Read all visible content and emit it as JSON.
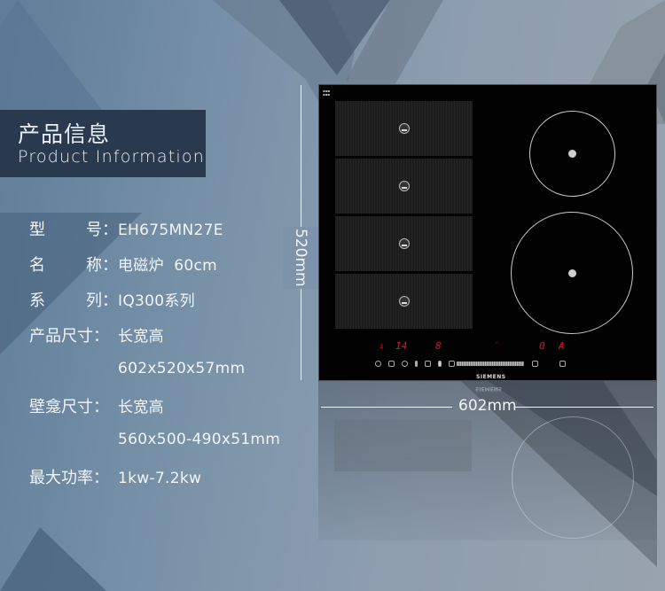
{
  "header": {
    "title_cn": "产品信息",
    "title_en": "Product Information"
  },
  "specs": [
    {
      "label_chars": [
        "型",
        "号："
      ],
      "value": "EH675MN27E"
    },
    {
      "label_chars": [
        "名",
        "称："
      ],
      "value": "电磁炉  60cm"
    },
    {
      "label_chars": [
        "系",
        "列："
      ],
      "value": "IQ300系列"
    },
    {
      "label": "产品尺寸：",
      "value": "长宽高"
    },
    {
      "label": "",
      "value": "602x520x57mm"
    },
    {
      "label": "壁龛尺寸：",
      "value": "长宽高"
    },
    {
      "label": "",
      "value": "560x500-490x51mm"
    },
    {
      "label": "最大功率：",
      "value": "1kw-7.2kw"
    }
  ],
  "dimensions": {
    "height_label": "520mm",
    "width_label": "602mm"
  },
  "cooktop": {
    "brand": "SIEMENS",
    "flex_zones": 4,
    "round_zones": 2,
    "displays": [
      "14",
      "8",
      "0",
      "A"
    ],
    "display_color": "#e4141a"
  }
}
